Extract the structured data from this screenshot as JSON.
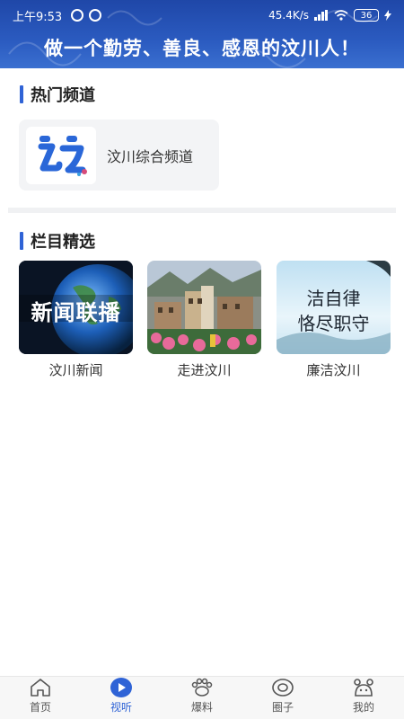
{
  "status_bar": {
    "time": "上午9:53",
    "network_speed": "45.4K/s",
    "battery": "36"
  },
  "header": {
    "slogan": "做一个勤劳、善良、感恩的汶川人！"
  },
  "hot_channels": {
    "title": "热门频道",
    "items": [
      {
        "name": "汶川综合频道",
        "icon": "wenchuan-tv-logo-icon"
      }
    ]
  },
  "featured_columns": {
    "title": "栏目精选",
    "items": [
      {
        "label": "汶川新闻",
        "thumb_text": "新闻联播"
      },
      {
        "label": "走进汶川"
      },
      {
        "label": "廉洁汶川",
        "thumb_lines": [
          "洁自律",
          "恪尽职守"
        ]
      }
    ]
  },
  "tab_bar": {
    "items": [
      {
        "label": "首页",
        "icon": "home-icon",
        "active": false
      },
      {
        "label": "视听",
        "icon": "play-icon",
        "active": true
      },
      {
        "label": "爆料",
        "icon": "paw-icon",
        "active": false
      },
      {
        "label": "圈子",
        "icon": "circle-icon",
        "active": false
      },
      {
        "label": "我的",
        "icon": "profile-icon",
        "active": false
      }
    ]
  },
  "colors": {
    "accent": "#2f63d6",
    "header_bg": "#2b5bc0"
  }
}
